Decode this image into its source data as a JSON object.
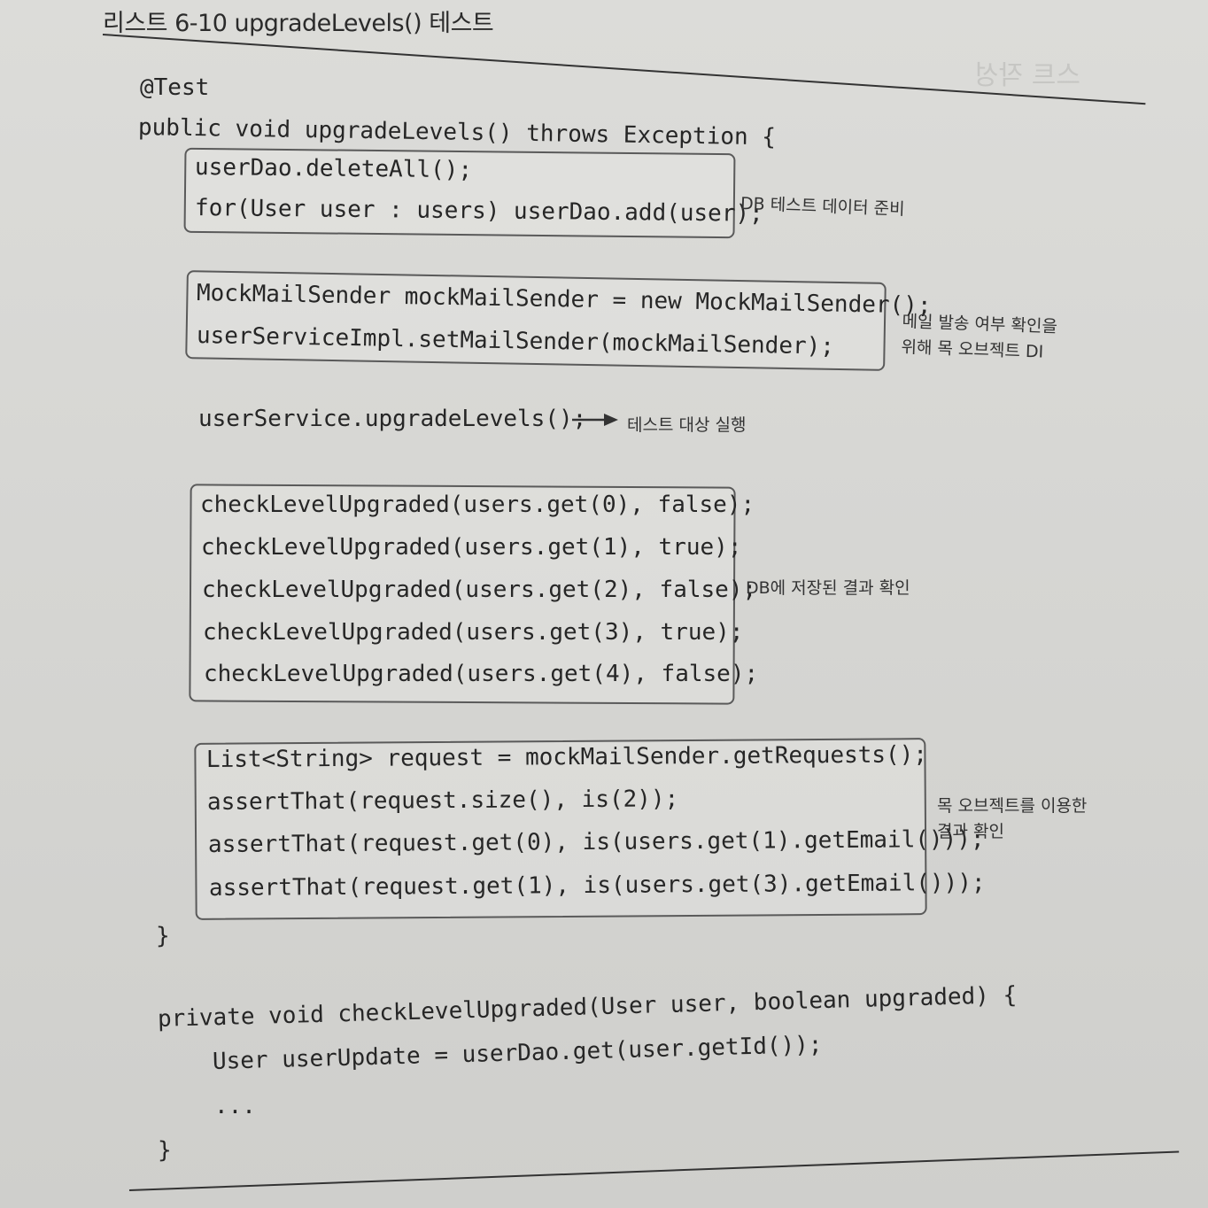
{
  "caption": "리스트 6-10 upgradeLevels() 테스트",
  "code": {
    "annotation": "@Test",
    "method_signature": "public void upgradeLevels() throws Exception {",
    "db_setup": [
      "userDao.deleteAll();",
      "for(User user : users) userDao.add(user);"
    ],
    "mock_setup": [
      "MockMailSender mockMailSender = new MockMailSender();",
      "userServiceImpl.setMailSender(mockMailSender);"
    ],
    "execute": "userService.upgradeLevels();",
    "checks": [
      "checkLevelUpgraded(users.get(0), false);",
      "checkLevelUpgraded(users.get(1), true);",
      "checkLevelUpgraded(users.get(2), false);",
      "checkLevelUpgraded(users.get(3), true);",
      "checkLevelUpgraded(users.get(4), false);"
    ],
    "mock_verify": [
      "List<String> request = mockMailSender.getRequests();",
      "assertThat(request.size(), is(2));",
      "assertThat(request.get(0), is(users.get(1).getEmail()));",
      "assertThat(request.get(1), is(users.get(3).getEmail()));"
    ],
    "close_brace_1": "}",
    "helper_signature": "private void checkLevelUpgraded(User user, boolean upgraded) {",
    "helper_body_1": "User userUpdate = userDao.get(user.getId());",
    "helper_ellipsis": "...",
    "close_brace_2": "}"
  },
  "notes": {
    "db_setup": "DB 테스트 데이터 준비",
    "mock_setup": "메일 발송 여부 확인을\n위해 목 오브젝트 DI",
    "execute": "테스트 대상 실행",
    "checks": "DB에 저장된 결과 확인",
    "mock_verify": "목 오브젝트를 이용한\n결과 확인"
  }
}
